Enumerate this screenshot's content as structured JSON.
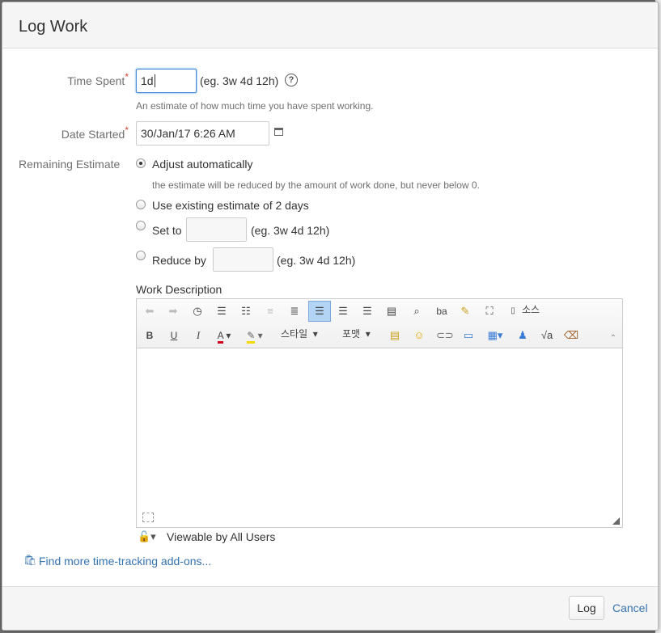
{
  "dialog": {
    "title": "Log Work"
  },
  "time_spent": {
    "label": "Time Spent",
    "required": "*",
    "value": "1d",
    "example": "(eg. 3w 4d 12h)",
    "help_icon": "question-circle-icon",
    "description": "An estimate of how much time you have spent working."
  },
  "date_started": {
    "label": "Date Started",
    "required": "*",
    "value": "30/Jan/17 6:26 AM",
    "calendar_icon": "calendar-icon"
  },
  "remaining_estimate": {
    "label": "Remaining Estimate",
    "options": [
      {
        "label": "Adjust automatically",
        "selected": true,
        "hint": "the estimate will be reduced by the amount of work done, but never below 0."
      },
      {
        "label": "Use existing estimate of 2 days",
        "selected": false
      },
      {
        "label": "Set to",
        "selected": false,
        "example": "(eg. 3w 4d 12h)"
      },
      {
        "label": "Reduce by",
        "selected": false,
        "example": "(eg. 3w 4d 12h)"
      }
    ]
  },
  "work_description": {
    "label": "Work Description",
    "toolbar": {
      "source_label": "소스",
      "style_label": "스타일",
      "format_label": "포맷"
    },
    "value": ""
  },
  "visibility": {
    "label": "Viewable by All Users",
    "icon": "lock-icon"
  },
  "addons_link": {
    "label": "Find more time-tracking add-ons...",
    "icon": "marketplace-icon"
  },
  "footer": {
    "log_label": "Log",
    "cancel_label": "Cancel"
  },
  "colors": {
    "link": "#3572b0",
    "required": "#d04437",
    "focus": "#4a8cd9"
  }
}
